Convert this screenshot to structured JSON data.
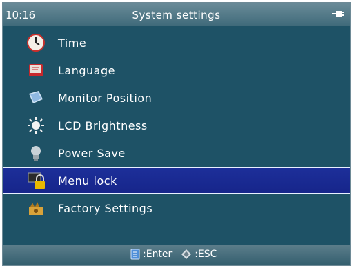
{
  "header": {
    "time": "10:16",
    "title": "System settings",
    "status_icon": "power-plug-icon"
  },
  "menu": {
    "items": [
      {
        "label": "Time",
        "icon": "clock-icon"
      },
      {
        "label": "Language",
        "icon": "language-book-icon"
      },
      {
        "label": "Monitor Position",
        "icon": "monitor-position-icon"
      },
      {
        "label": "LCD Brightness",
        "icon": "brightness-sun-icon"
      },
      {
        "label": "Power Save",
        "icon": "lightbulb-icon"
      },
      {
        "label": "Menu lock",
        "icon": "padlock-icon",
        "selected": true
      },
      {
        "label": "Factory Settings",
        "icon": "factory-reset-icon"
      }
    ]
  },
  "footer": {
    "enter_label": ":Enter",
    "enter_icon": "enter-key-icon",
    "esc_label": ":ESC",
    "esc_icon": "directional-pad-icon"
  },
  "colors": {
    "background": "#1e5266",
    "selected": "#1d2f9a",
    "header": "#4f7584"
  }
}
